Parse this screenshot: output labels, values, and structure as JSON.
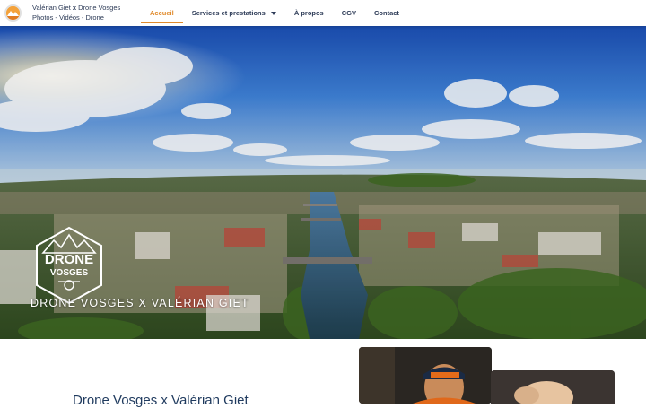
{
  "header": {
    "brand_line1_a": "Valérian Giet ",
    "brand_line1_x": "x",
    "brand_line1_b": " Drone Vosges",
    "brand_line2": "Photos - Vidéos - Drone",
    "logo_icon": "drone-vosges-logo-icon"
  },
  "nav": {
    "items": [
      {
        "label": "Accueil",
        "active": true
      },
      {
        "label": "Services et prestations",
        "has_dropdown": true
      },
      {
        "label": "À propos"
      },
      {
        "label": "CGV"
      },
      {
        "label": "Contact"
      }
    ],
    "dropdown_icon": "caret-down-icon"
  },
  "hero": {
    "logo_text_top": "DRONE",
    "logo_text_bottom": "VOSGES",
    "title": "DRONE VOSGES X VALÉRIAN GIET",
    "image": "aerial-panorama-of-city-with-river"
  },
  "main": {
    "heading": "Drone Vosges x Valérian Giet"
  },
  "colors": {
    "accent": "#e08a2b",
    "nav_text": "#2d3b57",
    "heading": "#1f3a5e"
  }
}
